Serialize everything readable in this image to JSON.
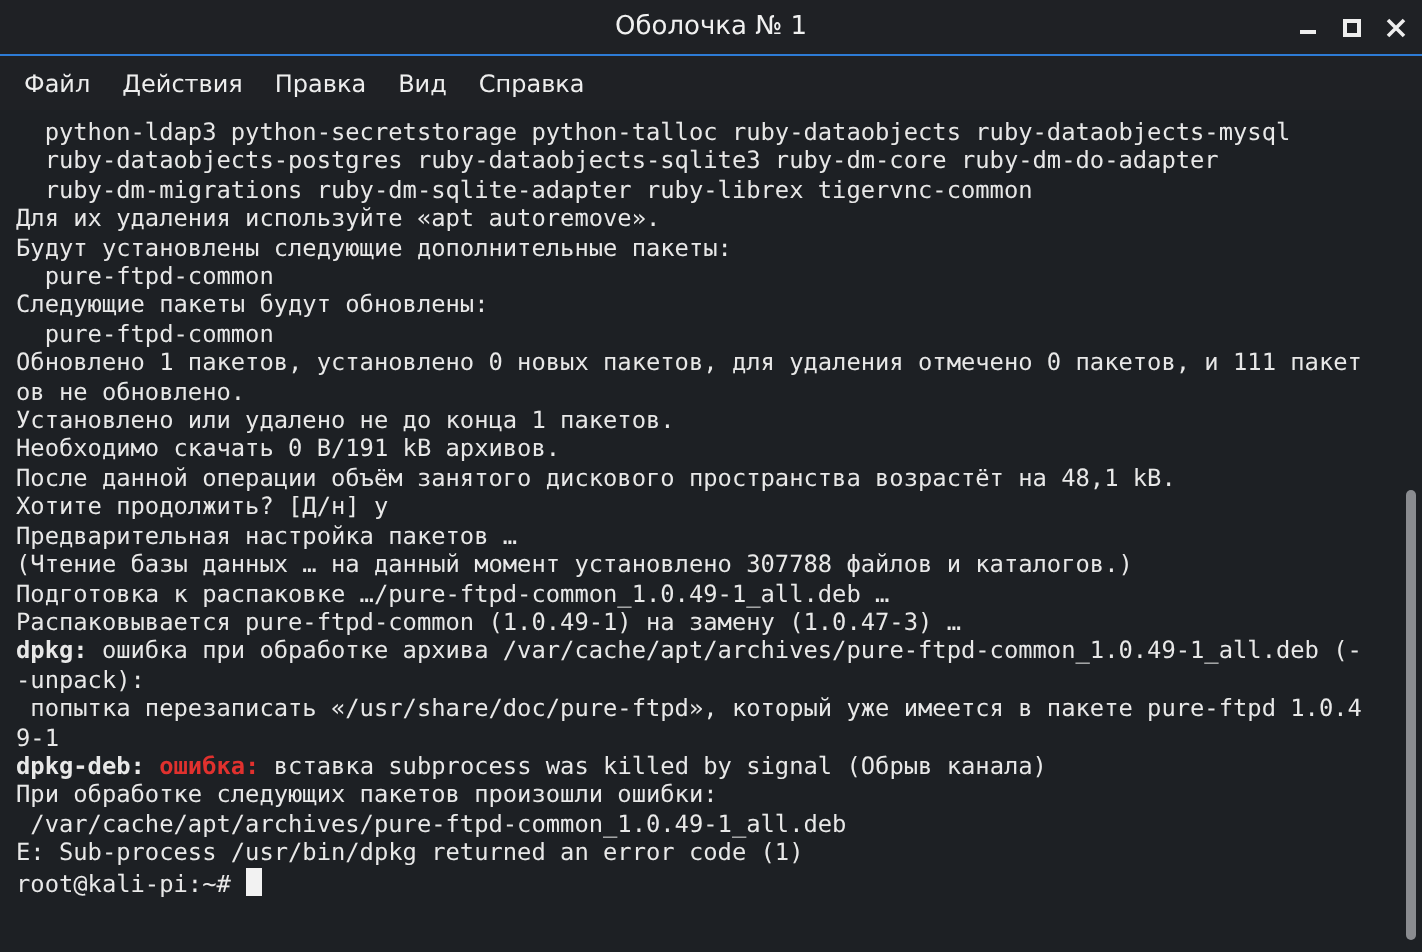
{
  "window": {
    "title": "Оболочка № 1"
  },
  "menu": [
    "Файл",
    "Действия",
    "Правка",
    "Вид",
    "Справка"
  ],
  "terminal": {
    "lines": [
      [
        {
          "kind": "plain",
          "text": "  python-ldap3 python-secretstorage python-talloc ruby-dataobjects ruby-dataobjects-mysql"
        }
      ],
      [
        {
          "kind": "plain",
          "text": "  ruby-dataobjects-postgres ruby-dataobjects-sqlite3 ruby-dm-core ruby-dm-do-adapter"
        }
      ],
      [
        {
          "kind": "plain",
          "text": "  ruby-dm-migrations ruby-dm-sqlite-adapter ruby-librex tigervnc-common"
        }
      ],
      [
        {
          "kind": "plain",
          "text": "Для их удаления используйте «apt autoremove»."
        }
      ],
      [
        {
          "kind": "plain",
          "text": "Будут установлены следующие дополнительные пакеты:"
        }
      ],
      [
        {
          "kind": "plain",
          "text": "  pure-ftpd-common"
        }
      ],
      [
        {
          "kind": "plain",
          "text": "Следующие пакеты будут обновлены:"
        }
      ],
      [
        {
          "kind": "plain",
          "text": "  pure-ftpd-common"
        }
      ],
      [
        {
          "kind": "plain",
          "text": "Обновлено 1 пакетов, установлено 0 новых пакетов, для удаления отмечено 0 пакетов, и 111 пакет"
        }
      ],
      [
        {
          "kind": "plain",
          "text": "ов не обновлено."
        }
      ],
      [
        {
          "kind": "plain",
          "text": "Установлено или удалено не до конца 1 пакетов."
        }
      ],
      [
        {
          "kind": "plain",
          "text": "Необходимо скачать 0 B/191 kB архивов."
        }
      ],
      [
        {
          "kind": "plain",
          "text": "После данной операции объём занятого дискового пространства возрастёт на 48,1 kB."
        }
      ],
      [
        {
          "kind": "plain",
          "text": "Хотите продолжить? [Д/н] y"
        }
      ],
      [
        {
          "kind": "plain",
          "text": "Предварительная настройка пакетов …"
        }
      ],
      [
        {
          "kind": "plain",
          "text": "(Чтение базы данных … на данный момент установлено 307788 файлов и каталогов.)"
        }
      ],
      [
        {
          "kind": "plain",
          "text": "Подготовка к распаковке …/pure-ftpd-common_1.0.49-1_all.deb …"
        }
      ],
      [
        {
          "kind": "plain",
          "text": "Распаковывается pure-ftpd-common (1.0.49-1) на замену (1.0.47-3) …"
        }
      ],
      [
        {
          "kind": "bold",
          "text": "dpkg:"
        },
        {
          "kind": "plain",
          "text": " ошибка при обработке архива /var/cache/apt/archives/pure-ftpd-common_1.0.49-1_all.deb (-"
        }
      ],
      [
        {
          "kind": "plain",
          "text": "-unpack):"
        }
      ],
      [
        {
          "kind": "plain",
          "text": " попытка перезаписать «/usr/share/doc/pure-ftpd», который уже имеется в пакете pure-ftpd 1.0.4"
        }
      ],
      [
        {
          "kind": "plain",
          "text": "9-1"
        }
      ],
      [
        {
          "kind": "bold",
          "text": "dpkg-deb: "
        },
        {
          "kind": "error",
          "text": "ошибка:"
        },
        {
          "kind": "plain",
          "text": " вставка subprocess was killed by signal (Обрыв канала)"
        }
      ],
      [
        {
          "kind": "plain",
          "text": "При обработке следующих пакетов произошли ошибки:"
        }
      ],
      [
        {
          "kind": "plain",
          "text": " /var/cache/apt/archives/pure-ftpd-common_1.0.49-1_all.deb"
        }
      ],
      [
        {
          "kind": "plain",
          "text": "E: Sub-process /usr/bin/dpkg returned an error code (1)"
        }
      ],
      [
        {
          "kind": "plain",
          "text": "root@kali-pi:~# "
        }
      ]
    ],
    "cursor": true
  }
}
